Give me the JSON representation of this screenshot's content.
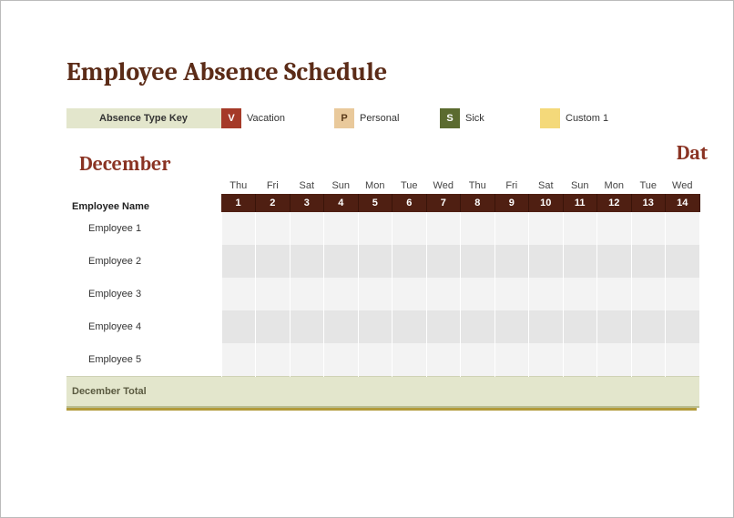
{
  "title": "Employee Absence Schedule",
  "key_bar": {
    "label": "Absence Type Key",
    "items": [
      {
        "code": "V",
        "label": "Vacation"
      },
      {
        "code": "P",
        "label": "Personal"
      },
      {
        "code": "S",
        "label": "Sick"
      },
      {
        "code": "",
        "label": "Custom 1"
      }
    ]
  },
  "month": "December",
  "dates_heading": "Dat",
  "name_header": "Employee Name",
  "days": [
    {
      "dow": "Thu",
      "num": "1"
    },
    {
      "dow": "Fri",
      "num": "2"
    },
    {
      "dow": "Sat",
      "num": "3"
    },
    {
      "dow": "Sun",
      "num": "4"
    },
    {
      "dow": "Mon",
      "num": "5"
    },
    {
      "dow": "Tue",
      "num": "6"
    },
    {
      "dow": "Wed",
      "num": "7"
    },
    {
      "dow": "Thu",
      "num": "8"
    },
    {
      "dow": "Fri",
      "num": "9"
    },
    {
      "dow": "Sat",
      "num": "10"
    },
    {
      "dow": "Sun",
      "num": "11"
    },
    {
      "dow": "Mon",
      "num": "12"
    },
    {
      "dow": "Tue",
      "num": "13"
    },
    {
      "dow": "Wed",
      "num": "14"
    }
  ],
  "employees": [
    "Employee 1",
    "Employee 2",
    "Employee 3",
    "Employee 4",
    "Employee 5"
  ],
  "total_label": "December Total"
}
